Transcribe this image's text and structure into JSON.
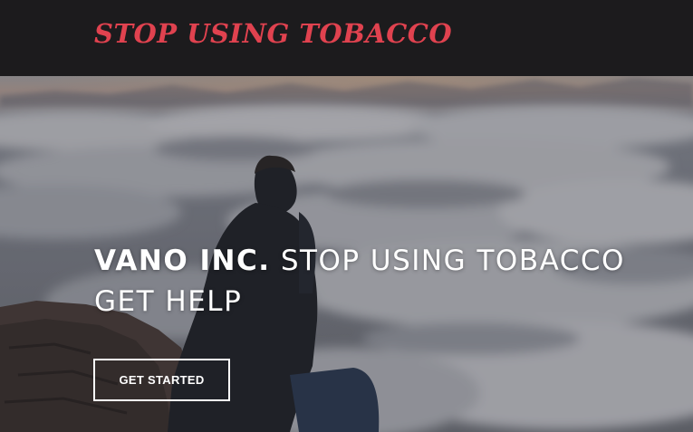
{
  "navbar": {
    "brand": "STOP USING TOBACCO"
  },
  "hero": {
    "title_strong": "VANO INC.",
    "title_rest": "STOP USING TOBACCO",
    "title_line2": "GET HELP",
    "cta_label": "GET STARTED"
  },
  "colors": {
    "brand": "#e0424f",
    "navbar_bg": "#1c1b1d",
    "text": "#ffffff"
  }
}
